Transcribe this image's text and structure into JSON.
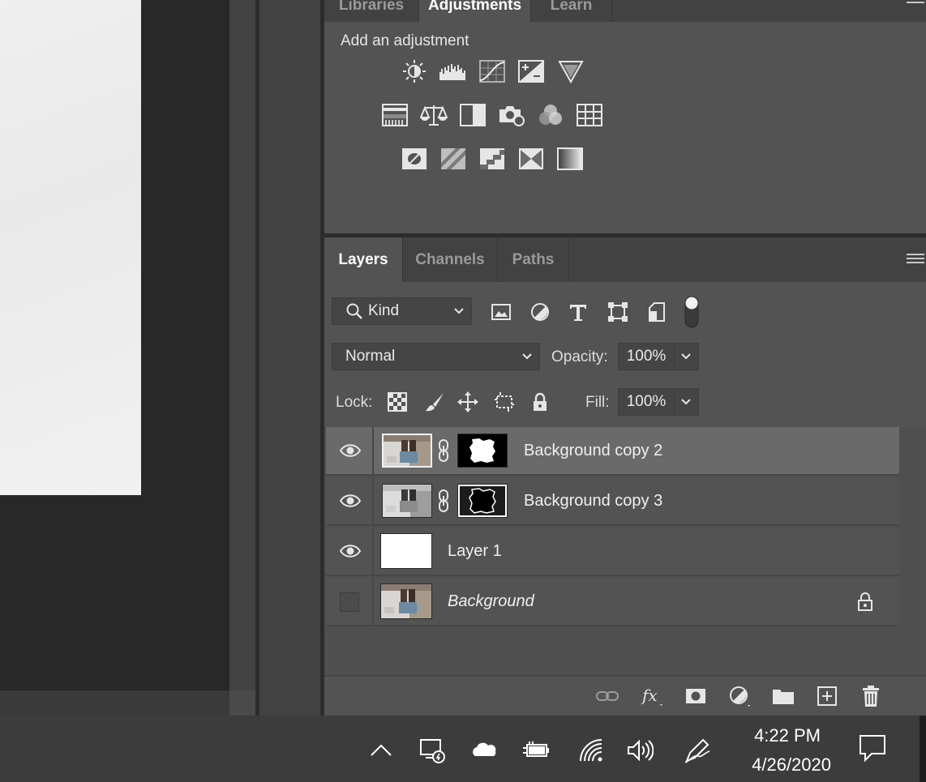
{
  "adjustments_panel": {
    "tabs": [
      "Libraries",
      "Adjustments",
      "Learn"
    ],
    "active_tab": "Adjustments",
    "title": "Add an adjustment",
    "icons_row1": [
      "brightness-contrast-icon",
      "levels-icon",
      "curves-icon",
      "exposure-icon",
      "vibrance-icon"
    ],
    "icons_row2": [
      "hue-saturation-icon",
      "color-balance-icon",
      "black-white-icon",
      "photo-filter-icon",
      "channel-mixer-icon",
      "color-lookup-icon"
    ],
    "icons_row3": [
      "invert-icon",
      "posterize-icon",
      "threshold-icon",
      "selective-color-icon",
      "gradient-map-icon"
    ]
  },
  "layers_panel": {
    "tabs": [
      "Layers",
      "Channels",
      "Paths"
    ],
    "active_tab": "Layers",
    "filter": {
      "value": "Kind"
    },
    "blend_mode": "Normal",
    "opacity_label": "Opacity:",
    "opacity_value": "100%",
    "lock_label": "Lock:",
    "fill_label": "Fill:",
    "fill_value": "100%",
    "layers": [
      {
        "name": "Background copy 2",
        "visible": true,
        "selected": true,
        "has_mask": true,
        "mask": "white-on-black"
      },
      {
        "name": "Background copy 3",
        "visible": true,
        "selected": false,
        "has_mask": true,
        "mask": "black-on-white"
      },
      {
        "name": "Layer 1",
        "visible": true,
        "selected": false,
        "has_mask": false
      },
      {
        "name": "Background",
        "visible": false,
        "selected": false,
        "has_mask": false,
        "locked": true,
        "italic": true
      }
    ]
  },
  "taskbar": {
    "time": "4:22 PM",
    "date": "4/26/2020"
  },
  "colors": {
    "panel_bg": "#535353",
    "tab_bar_bg": "#424242",
    "selected_layer": "#6a6a6a",
    "canvas_bg": "#282828",
    "taskbar_bg": "#3c3c3c"
  }
}
